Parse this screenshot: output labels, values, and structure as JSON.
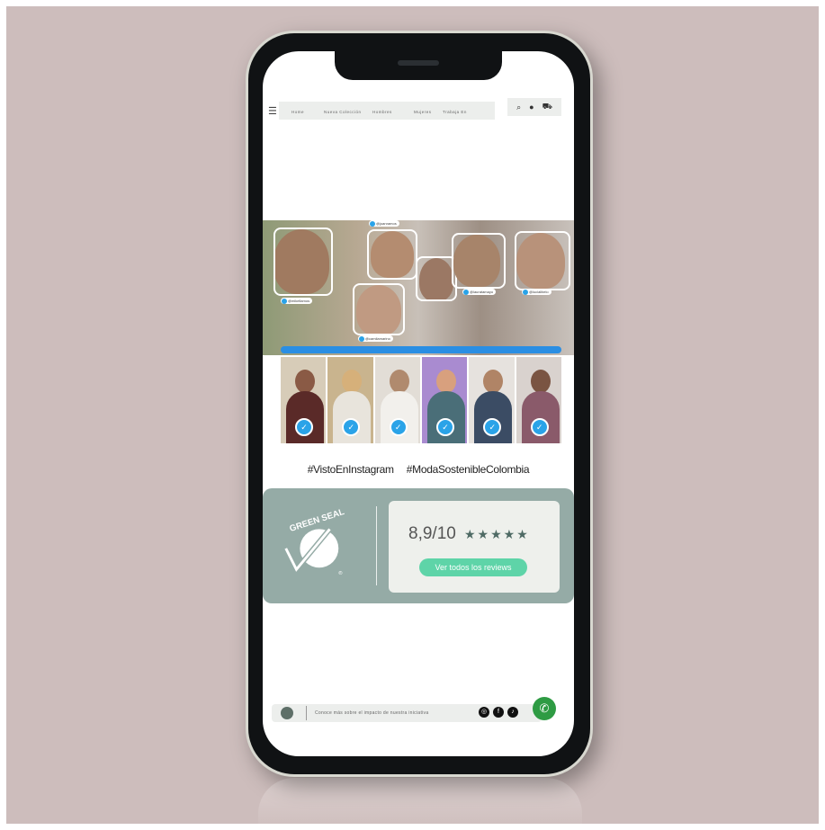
{
  "nav": {
    "menu_icon": "hamburger-icon",
    "links": [
      "Home",
      "Nueva Colección",
      "Hombres",
      "Mujeres",
      "Trabaja En"
    ],
    "icons": [
      "search-icon",
      "user-icon",
      "cart-icon"
    ]
  },
  "hero": {
    "tags": [
      "@joanramos",
      "@mikellamos",
      "@camilamarino",
      "@lauratamayo",
      "@andreaariza",
      "@lucialibelo"
    ]
  },
  "hashtags": [
    "#VistoEnInstagram",
    "#ModaSostenibleColombia"
  ],
  "seal": {
    "text": "GREEN SEAL",
    "registered": "®"
  },
  "rating": {
    "score": "8,9/10",
    "stars": "★★★★★",
    "reviews_button": "Ver todos los reviews"
  },
  "footer": {
    "text": "Conoce más sobre el impacto de nuestra iniciativa",
    "social_icons": [
      "instagram-icon",
      "facebook-icon",
      "tiktok-icon"
    ],
    "whatsapp_icon": "whatsapp-icon"
  },
  "colors": {
    "accent_blue": "#2a8ee3",
    "seal_panel": "#95aba6",
    "button_green": "#5ed4a8",
    "whatsapp": "#2e9b43"
  }
}
